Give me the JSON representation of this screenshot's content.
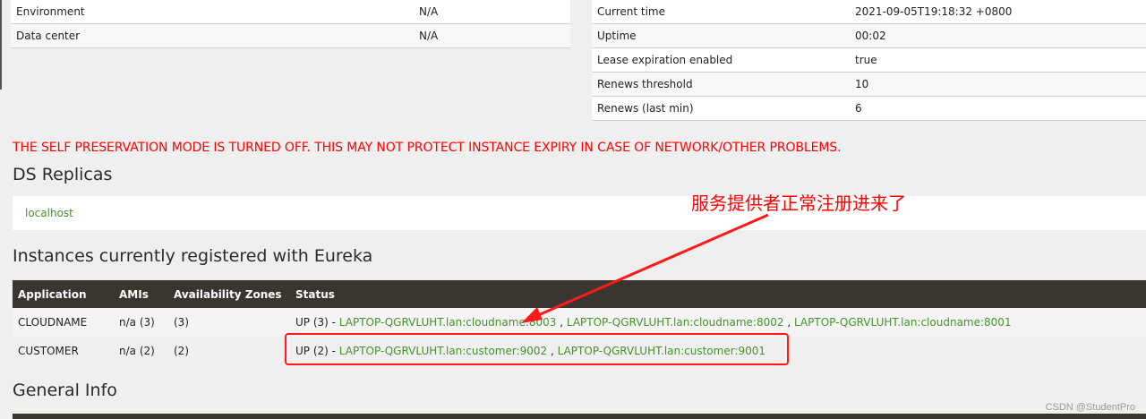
{
  "environment_table": [
    {
      "key": "Environment",
      "value": "N/A"
    },
    {
      "key": "Data center",
      "value": "N/A"
    }
  ],
  "status_table": [
    {
      "key": "Current time",
      "value": "2021-09-05T19:18:32 +0800"
    },
    {
      "key": "Uptime",
      "value": "00:02"
    },
    {
      "key": "Lease expiration enabled",
      "value": "true"
    },
    {
      "key": "Renews threshold",
      "value": "10"
    },
    {
      "key": "Renews (last min)",
      "value": "6"
    }
  ],
  "warning": "THE SELF PRESERVATION MODE IS TURNED OFF. THIS MAY NOT PROTECT INSTANCE EXPIRY IN CASE OF NETWORK/OTHER PROBLEMS.",
  "ds_replicas": {
    "title": "DS Replicas",
    "items": [
      "localhost"
    ]
  },
  "instances": {
    "title": "Instances currently registered with Eureka",
    "headers": [
      "Application",
      "AMIs",
      "Availability Zones",
      "Status"
    ],
    "rows": [
      {
        "application": "CLOUDNAME",
        "amis": "n/a (3)",
        "zones": "(3)",
        "status_prefix": "UP (3) - ",
        "links": [
          "LAPTOP-QGRVLUHT.lan:cloudname:8003",
          "LAPTOP-QGRVLUHT.lan:cloudname:8002",
          "LAPTOP-QGRVLUHT.lan:cloudname:8001"
        ]
      },
      {
        "application": "CUSTOMER",
        "amis": "n/a (2)",
        "zones": "(2)",
        "status_prefix": "UP (2) - ",
        "links": [
          "LAPTOP-QGRVLUHT.lan:customer:9002",
          "LAPTOP-QGRVLUHT.lan:customer:9001"
        ]
      }
    ]
  },
  "general_info": {
    "title": "General Info"
  },
  "annotation": "服务提供者正常注册进来了",
  "watermark": "CSDN @StudentPro",
  "colors": {
    "link": "#4a8f2e",
    "warning": "#ff0000",
    "header_bg": "#3b3530",
    "annotation": "#ff0000"
  }
}
